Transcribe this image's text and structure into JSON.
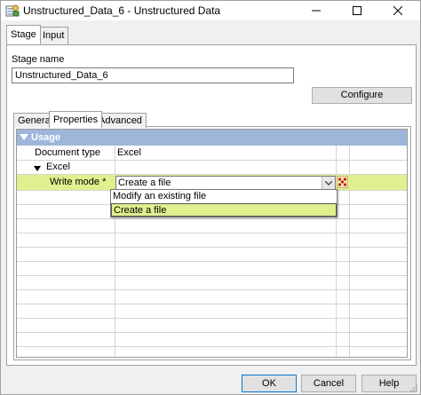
{
  "window": {
    "title": "Unstructured_Data_6 - Unstructured Data",
    "min_glyph": "—",
    "max_glyph": "☐",
    "close_glyph": "✕"
  },
  "tabs_top": [
    {
      "label": "Stage",
      "active": true
    },
    {
      "label": "Input",
      "active": false
    }
  ],
  "stage": {
    "name_label": "Stage name",
    "name_value": "Unstructured_Data_6",
    "configure_label": "Configure"
  },
  "tabs_inner": [
    {
      "label": "General",
      "active": false
    },
    {
      "label": "Properties",
      "active": true
    },
    {
      "label": "Advanced",
      "active": false
    }
  ],
  "properties": {
    "section": "Usage",
    "rows": [
      {
        "name": "Document type",
        "value": "Excel"
      },
      {
        "name": "Excel",
        "value": ""
      },
      {
        "name": "Write mode *",
        "value": "Create a file"
      }
    ],
    "dropdown_options": [
      "Modify an existing file",
      "Create a file"
    ],
    "selected_option": "Create a file"
  },
  "buttons": {
    "ok": "OK",
    "cancel": "Cancel",
    "help": "Help"
  },
  "colors": {
    "usage_header": "#9fb6db",
    "highlight": "#e0f08e"
  }
}
